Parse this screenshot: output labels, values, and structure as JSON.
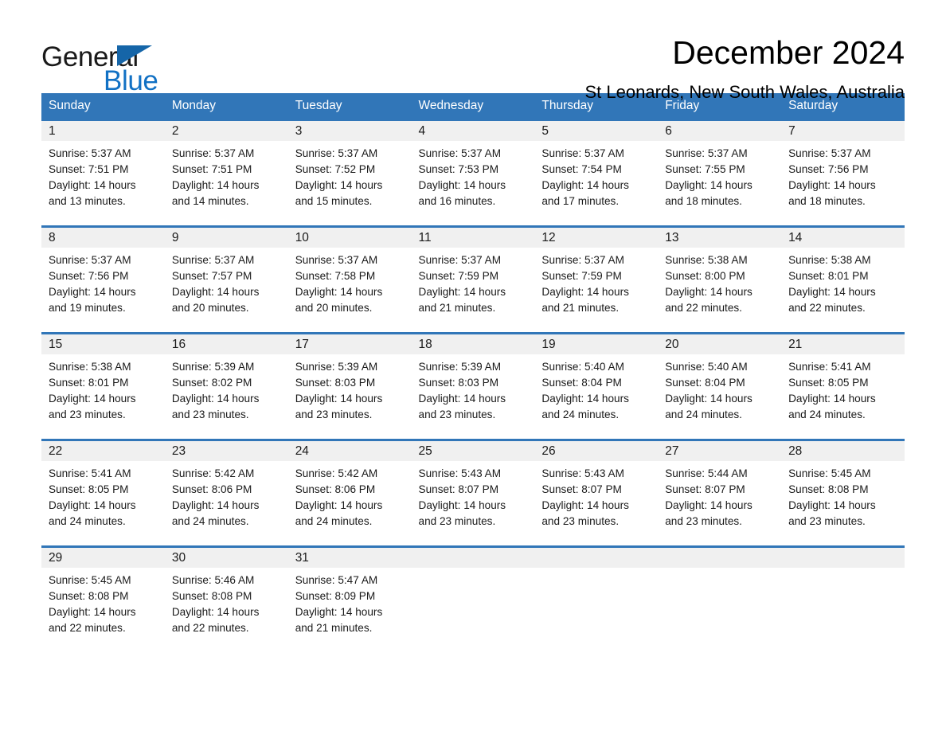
{
  "logo": {
    "word_general": "General",
    "word_blue": "Blue",
    "triangle_color": "#1565a8",
    "blue_text_color": "#1271c4"
  },
  "header": {
    "title": "December 2024",
    "subtitle": "St Leonards, New South Wales, Australia"
  },
  "theme": {
    "header_blue": "#3176b8",
    "row_divider_blue": "#3176b8",
    "daynum_band_gray": "#f0f0f0"
  },
  "calendar": {
    "weekday_headers": [
      "Sunday",
      "Monday",
      "Tuesday",
      "Wednesday",
      "Thursday",
      "Friday",
      "Saturday"
    ],
    "weeks": [
      [
        {
          "day": "1",
          "sunrise": "Sunrise: 5:37 AM",
          "sunset": "Sunset: 7:51 PM",
          "daylight_line1": "Daylight: 14 hours",
          "daylight_line2": "and 13 minutes."
        },
        {
          "day": "2",
          "sunrise": "Sunrise: 5:37 AM",
          "sunset": "Sunset: 7:51 PM",
          "daylight_line1": "Daylight: 14 hours",
          "daylight_line2": "and 14 minutes."
        },
        {
          "day": "3",
          "sunrise": "Sunrise: 5:37 AM",
          "sunset": "Sunset: 7:52 PM",
          "daylight_line1": "Daylight: 14 hours",
          "daylight_line2": "and 15 minutes."
        },
        {
          "day": "4",
          "sunrise": "Sunrise: 5:37 AM",
          "sunset": "Sunset: 7:53 PM",
          "daylight_line1": "Daylight: 14 hours",
          "daylight_line2": "and 16 minutes."
        },
        {
          "day": "5",
          "sunrise": "Sunrise: 5:37 AM",
          "sunset": "Sunset: 7:54 PM",
          "daylight_line1": "Daylight: 14 hours",
          "daylight_line2": "and 17 minutes."
        },
        {
          "day": "6",
          "sunrise": "Sunrise: 5:37 AM",
          "sunset": "Sunset: 7:55 PM",
          "daylight_line1": "Daylight: 14 hours",
          "daylight_line2": "and 18 minutes."
        },
        {
          "day": "7",
          "sunrise": "Sunrise: 5:37 AM",
          "sunset": "Sunset: 7:56 PM",
          "daylight_line1": "Daylight: 14 hours",
          "daylight_line2": "and 18 minutes."
        }
      ],
      [
        {
          "day": "8",
          "sunrise": "Sunrise: 5:37 AM",
          "sunset": "Sunset: 7:56 PM",
          "daylight_line1": "Daylight: 14 hours",
          "daylight_line2": "and 19 minutes."
        },
        {
          "day": "9",
          "sunrise": "Sunrise: 5:37 AM",
          "sunset": "Sunset: 7:57 PM",
          "daylight_line1": "Daylight: 14 hours",
          "daylight_line2": "and 20 minutes."
        },
        {
          "day": "10",
          "sunrise": "Sunrise: 5:37 AM",
          "sunset": "Sunset: 7:58 PM",
          "daylight_line1": "Daylight: 14 hours",
          "daylight_line2": "and 20 minutes."
        },
        {
          "day": "11",
          "sunrise": "Sunrise: 5:37 AM",
          "sunset": "Sunset: 7:59 PM",
          "daylight_line1": "Daylight: 14 hours",
          "daylight_line2": "and 21 minutes."
        },
        {
          "day": "12",
          "sunrise": "Sunrise: 5:37 AM",
          "sunset": "Sunset: 7:59 PM",
          "daylight_line1": "Daylight: 14 hours",
          "daylight_line2": "and 21 minutes."
        },
        {
          "day": "13",
          "sunrise": "Sunrise: 5:38 AM",
          "sunset": "Sunset: 8:00 PM",
          "daylight_line1": "Daylight: 14 hours",
          "daylight_line2": "and 22 minutes."
        },
        {
          "day": "14",
          "sunrise": "Sunrise: 5:38 AM",
          "sunset": "Sunset: 8:01 PM",
          "daylight_line1": "Daylight: 14 hours",
          "daylight_line2": "and 22 minutes."
        }
      ],
      [
        {
          "day": "15",
          "sunrise": "Sunrise: 5:38 AM",
          "sunset": "Sunset: 8:01 PM",
          "daylight_line1": "Daylight: 14 hours",
          "daylight_line2": "and 23 minutes."
        },
        {
          "day": "16",
          "sunrise": "Sunrise: 5:39 AM",
          "sunset": "Sunset: 8:02 PM",
          "daylight_line1": "Daylight: 14 hours",
          "daylight_line2": "and 23 minutes."
        },
        {
          "day": "17",
          "sunrise": "Sunrise: 5:39 AM",
          "sunset": "Sunset: 8:03 PM",
          "daylight_line1": "Daylight: 14 hours",
          "daylight_line2": "and 23 minutes."
        },
        {
          "day": "18",
          "sunrise": "Sunrise: 5:39 AM",
          "sunset": "Sunset: 8:03 PM",
          "daylight_line1": "Daylight: 14 hours",
          "daylight_line2": "and 23 minutes."
        },
        {
          "day": "19",
          "sunrise": "Sunrise: 5:40 AM",
          "sunset": "Sunset: 8:04 PM",
          "daylight_line1": "Daylight: 14 hours",
          "daylight_line2": "and 24 minutes."
        },
        {
          "day": "20",
          "sunrise": "Sunrise: 5:40 AM",
          "sunset": "Sunset: 8:04 PM",
          "daylight_line1": "Daylight: 14 hours",
          "daylight_line2": "and 24 minutes."
        },
        {
          "day": "21",
          "sunrise": "Sunrise: 5:41 AM",
          "sunset": "Sunset: 8:05 PM",
          "daylight_line1": "Daylight: 14 hours",
          "daylight_line2": "and 24 minutes."
        }
      ],
      [
        {
          "day": "22",
          "sunrise": "Sunrise: 5:41 AM",
          "sunset": "Sunset: 8:05 PM",
          "daylight_line1": "Daylight: 14 hours",
          "daylight_line2": "and 24 minutes."
        },
        {
          "day": "23",
          "sunrise": "Sunrise: 5:42 AM",
          "sunset": "Sunset: 8:06 PM",
          "daylight_line1": "Daylight: 14 hours",
          "daylight_line2": "and 24 minutes."
        },
        {
          "day": "24",
          "sunrise": "Sunrise: 5:42 AM",
          "sunset": "Sunset: 8:06 PM",
          "daylight_line1": "Daylight: 14 hours",
          "daylight_line2": "and 24 minutes."
        },
        {
          "day": "25",
          "sunrise": "Sunrise: 5:43 AM",
          "sunset": "Sunset: 8:07 PM",
          "daylight_line1": "Daylight: 14 hours",
          "daylight_line2": "and 23 minutes."
        },
        {
          "day": "26",
          "sunrise": "Sunrise: 5:43 AM",
          "sunset": "Sunset: 8:07 PM",
          "daylight_line1": "Daylight: 14 hours",
          "daylight_line2": "and 23 minutes."
        },
        {
          "day": "27",
          "sunrise": "Sunrise: 5:44 AM",
          "sunset": "Sunset: 8:07 PM",
          "daylight_line1": "Daylight: 14 hours",
          "daylight_line2": "and 23 minutes."
        },
        {
          "day": "28",
          "sunrise": "Sunrise: 5:45 AM",
          "sunset": "Sunset: 8:08 PM",
          "daylight_line1": "Daylight: 14 hours",
          "daylight_line2": "and 23 minutes."
        }
      ],
      [
        {
          "day": "29",
          "sunrise": "Sunrise: 5:45 AM",
          "sunset": "Sunset: 8:08 PM",
          "daylight_line1": "Daylight: 14 hours",
          "daylight_line2": "and 22 minutes."
        },
        {
          "day": "30",
          "sunrise": "Sunrise: 5:46 AM",
          "sunset": "Sunset: 8:08 PM",
          "daylight_line1": "Daylight: 14 hours",
          "daylight_line2": "and 22 minutes."
        },
        {
          "day": "31",
          "sunrise": "Sunrise: 5:47 AM",
          "sunset": "Sunset: 8:09 PM",
          "daylight_line1": "Daylight: 14 hours",
          "daylight_line2": "and 21 minutes."
        },
        {
          "day": "",
          "sunrise": "",
          "sunset": "",
          "daylight_line1": "",
          "daylight_line2": ""
        },
        {
          "day": "",
          "sunrise": "",
          "sunset": "",
          "daylight_line1": "",
          "daylight_line2": ""
        },
        {
          "day": "",
          "sunrise": "",
          "sunset": "",
          "daylight_line1": "",
          "daylight_line2": ""
        },
        {
          "day": "",
          "sunrise": "",
          "sunset": "",
          "daylight_line1": "",
          "daylight_line2": ""
        }
      ]
    ]
  }
}
